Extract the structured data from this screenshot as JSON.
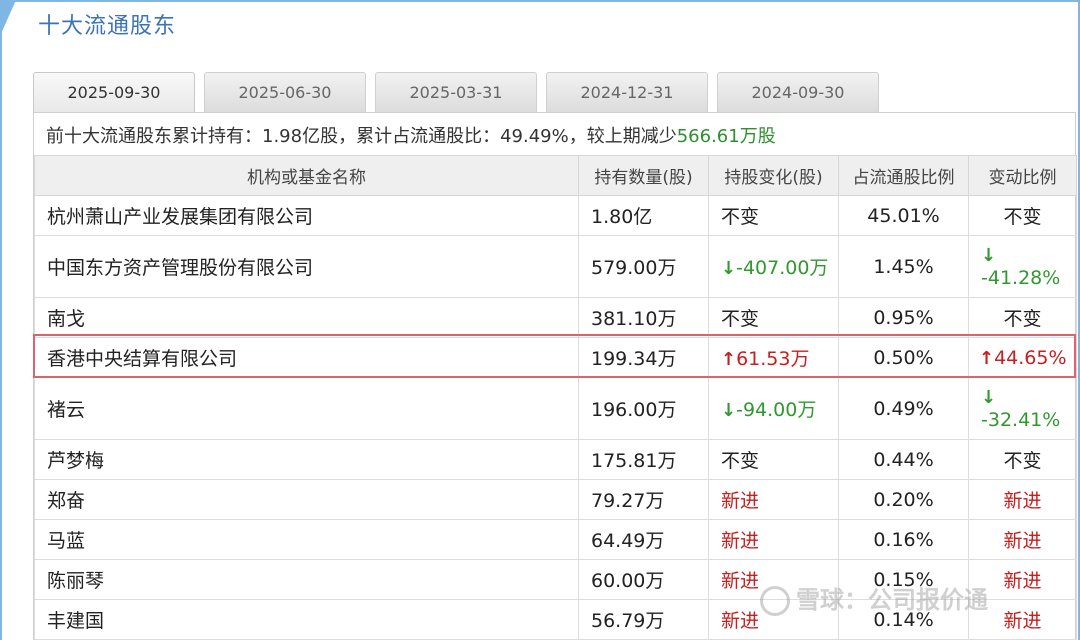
{
  "title": "十大流通股东",
  "tabs": [
    {
      "label": "2025-09-30",
      "active": true
    },
    {
      "label": "2025-06-30",
      "active": false
    },
    {
      "label": "2025-03-31",
      "active": false
    },
    {
      "label": "2024-12-31",
      "active": false
    },
    {
      "label": "2024-09-30",
      "active": false
    }
  ],
  "summary": {
    "prefix": "前十大流通股东累计持有：1.98亿股，累计占流通股比：49.49%，较上期减少",
    "change": "566.61万股"
  },
  "table": {
    "headers": [
      "机构或基金名称",
      "持有数量(股)",
      "持股变化(股)",
      "占流通股比例",
      "变动比例"
    ],
    "rows": [
      {
        "name": "杭州萧山产业发展集团有限公司",
        "qty": "1.80亿",
        "change": "不变",
        "change_dir": "none",
        "ratio": "45.01%",
        "pct": "不变",
        "pct_dir": "none"
      },
      {
        "name": "中国东方资产管理股份有限公司",
        "qty": "579.00万",
        "change": "-407.00万",
        "change_dir": "down",
        "ratio": "1.45%",
        "pct": "-41.28%",
        "pct_dir": "down"
      },
      {
        "name": "南戈",
        "qty": "381.10万",
        "change": "不变",
        "change_dir": "none",
        "ratio": "0.95%",
        "pct": "不变",
        "pct_dir": "none"
      },
      {
        "name": "香港中央结算有限公司",
        "qty": "199.34万",
        "change": "61.53万",
        "change_dir": "up",
        "ratio": "0.50%",
        "pct": "44.65%",
        "pct_dir": "up"
      },
      {
        "name": "褚云",
        "qty": "196.00万",
        "change": "-94.00万",
        "change_dir": "down",
        "ratio": "0.49%",
        "pct": "-32.41%",
        "pct_dir": "down"
      },
      {
        "name": "芦梦梅",
        "qty": "175.81万",
        "change": "不变",
        "change_dir": "none",
        "ratio": "0.44%",
        "pct": "不变",
        "pct_dir": "none"
      },
      {
        "name": "郑奋",
        "qty": "79.27万",
        "change": "新进",
        "change_dir": "new",
        "ratio": "0.20%",
        "pct": "新进",
        "pct_dir": "new"
      },
      {
        "name": "马蓝",
        "qty": "64.49万",
        "change": "新进",
        "change_dir": "new",
        "ratio": "0.16%",
        "pct": "新进",
        "pct_dir": "new"
      },
      {
        "name": "陈丽琴",
        "qty": "60.00万",
        "change": "新进",
        "change_dir": "new",
        "ratio": "0.15%",
        "pct": "新进",
        "pct_dir": "new"
      },
      {
        "name": "丰建国",
        "qty": "56.79万",
        "change": "新进",
        "change_dir": "new",
        "ratio": "0.14%",
        "pct": "新进",
        "pct_dir": "new"
      }
    ]
  },
  "highlight_row_index": 3,
  "colors": {
    "down": "#2e9a2e",
    "up": "#c81e1e",
    "title": "#3a74b8",
    "highlight_border": "#e0636b"
  },
  "watermark": "雪球：公司报价通"
}
